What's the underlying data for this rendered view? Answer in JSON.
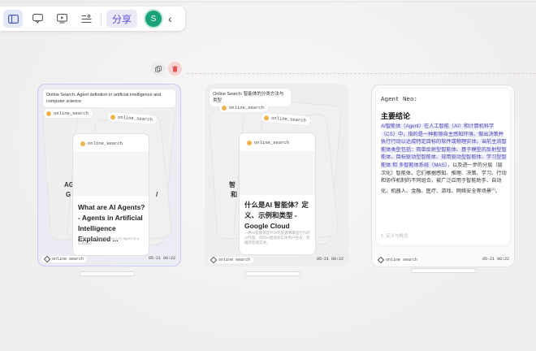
{
  "toolbar": {
    "share_label": "分享",
    "avatar_letter": "S"
  },
  "groups": [
    {
      "header": "Online Search: Agent definition in artificial intelligence and computer science",
      "chip_label": "online_search",
      "side_text_1": "AG",
      "side_text_2": "G",
      "front_title": "What are AI Agents?- Agents in Artificial Intelligence Explained ...",
      "front_snippet": "An artificial intelligence (AI) agent is a software",
      "footer_tag": "online search",
      "footer_time": "05-21 00:22"
    },
    {
      "header": "Online Search: 智能体的分类方法与类型",
      "chip_label": "online_search",
      "side_text_1": "智",
      "side_text_2": "和",
      "front_title": "什么是AI 智能体？定义、示例和类型 - Google Cloud",
      "front_snippet": "一种AI智能体是针对先前遇事最后行为的AI代理，的的AI智能体实体用户经去，而推荐智能实体。",
      "footer_tag": "online search",
      "footer_time": "05-21 00:22"
    }
  ],
  "agent": {
    "label": "Agent Neo:",
    "heading": "主要结论",
    "body_highlight": "AI智能体（Agent）在人工智能（AI）和计算机科学（CS）中，指的是一种能够自主感知环境、做出决策并执行行动以达成特定目标的软件或物理实体。当前主流智能体类型包括：简单反射型智能体、基于模型的反射型智能体、目标驱动型智能体、效用驱动型智能体、学习型智能体 和 多智能体系统（MAS）",
    "body_rest": "，以及进一步的分层（层次化）智能体。它们根据感知、推理、决策、学习、行动和协作机制的不同组合，被广泛应用于智能助手、自动化、机器人、金融、医疗、游戏、网络安全等场景",
    "body_ref": "[1]",
    "body_end": "。",
    "fade_text": "1. 定义与概念",
    "footer_tag": "online search",
    "footer_time": "05-21 00:22"
  }
}
